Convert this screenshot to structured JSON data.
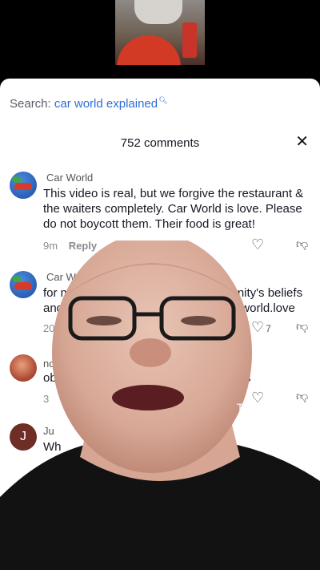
{
  "search": {
    "prefix": "Search:",
    "query": "car world explained",
    "icon": "search-icon"
  },
  "header": {
    "count_label": "752 comments",
    "close_glyph": "✕"
  },
  "comments": [
    {
      "author": "Car World",
      "text": "This video is real, but we forgive the restaurant & the waiters completely. Car World is love. Please do not boycott them. Their food is great!",
      "time": "9m",
      "reply": "Reply",
      "likes": ""
    },
    {
      "author": "Car Worl",
      "line1_a": "for mo",
      "line1_b": "munity's beliefs",
      "line2_a": "and",
      "line2_b": "arworld.love",
      "time": "20h",
      "likes": "7"
    },
    {
      "author": "nc",
      "line1": "ob",
      "line1_b": "s",
      "time": "3"
    },
    {
      "author": "Ju",
      "avatar_letter": "J",
      "line1": "Wh"
    }
  ],
  "watermark": {
    "brand": "TikTok",
    "handle": ""
  },
  "colors": {
    "link": "#2d6ed9",
    "sheet_bg": "#ffffff",
    "text": "#161823"
  }
}
